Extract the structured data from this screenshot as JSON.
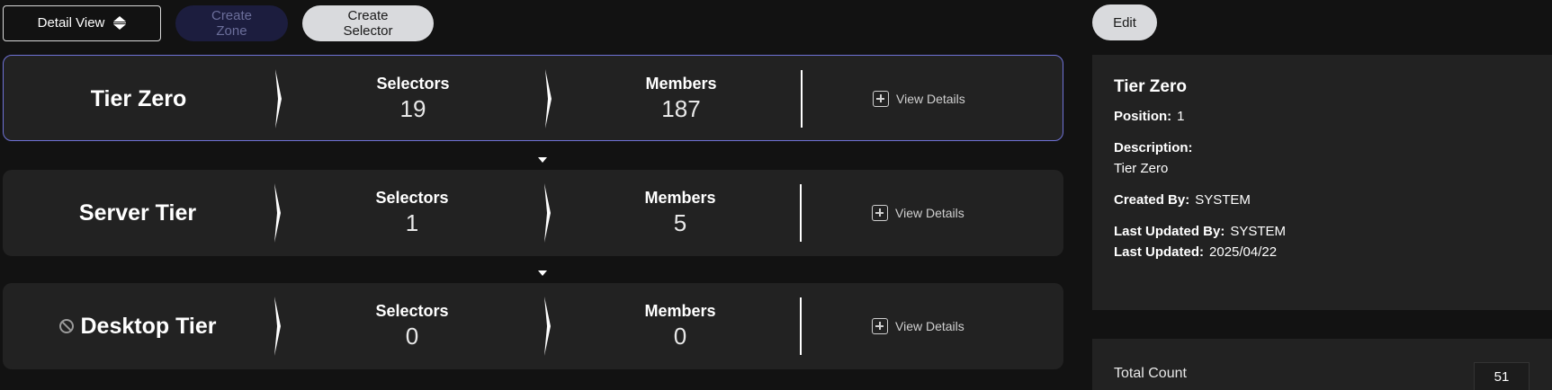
{
  "toolbar": {
    "view_mode": "Detail View",
    "create_zone": "Create Zone",
    "create_selector": "Create Selector",
    "edit": "Edit"
  },
  "zones": [
    {
      "name": "Tier Zero",
      "selectors_label": "Selectors",
      "selectors": "19",
      "members_label": "Members",
      "members": "187",
      "view_details": "View Details",
      "selected": true,
      "disabled": false
    },
    {
      "name": "Server Tier",
      "selectors_label": "Selectors",
      "selectors": "1",
      "members_label": "Members",
      "members": "5",
      "view_details": "View Details",
      "selected": false,
      "disabled": false
    },
    {
      "name": "Desktop Tier",
      "selectors_label": "Selectors",
      "selectors": "0",
      "members_label": "Members",
      "members": "0",
      "view_details": "View Details",
      "selected": false,
      "disabled": true
    }
  ],
  "details": {
    "title": "Tier Zero",
    "position_label": "Position:",
    "position": "1",
    "description_label": "Description:",
    "description": "Tier Zero",
    "created_by_label": "Created By:",
    "created_by": "SYSTEM",
    "last_updated_by_label": "Last Updated By:",
    "last_updated_by": "SYSTEM",
    "last_updated_label": "Last Updated:",
    "last_updated": "2025/04/22"
  },
  "count": {
    "label": "Total Count",
    "value": "51"
  },
  "colors": {
    "background": "#121212",
    "card": "#222222",
    "selected_border": "#6f72d6",
    "disabled_button": "#1c1d3e"
  }
}
